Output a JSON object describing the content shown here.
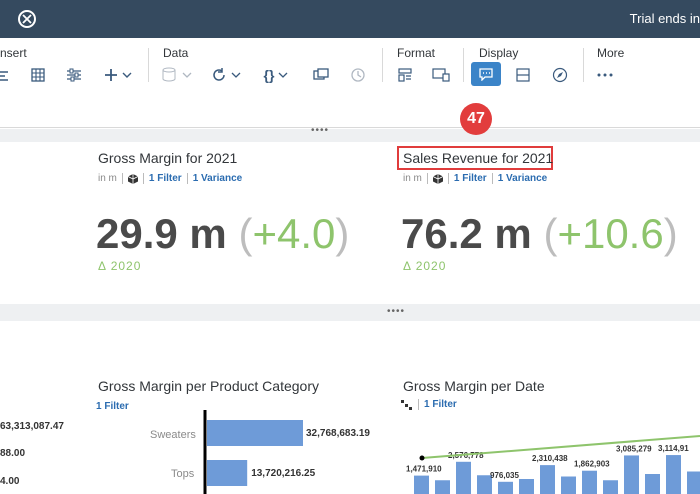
{
  "header": {
    "trial_text": "Trial ends in"
  },
  "toolbar": {
    "groups": {
      "insert": "nsert",
      "data": "Data",
      "format": "Format",
      "display": "Display",
      "more": "More"
    },
    "json_icon": "{}"
  },
  "step_badge": "47",
  "kpi_tiles": [
    {
      "title": "Gross Margin for 2021",
      "unit": "in m",
      "filter": "1 Filter",
      "variance": "1 Variance",
      "value": "29.9 m",
      "delta_value": "+4.0",
      "delta_label": "Δ 2020"
    },
    {
      "title": "Sales Revenue for 2021",
      "unit": "in m",
      "filter": "1 Filter",
      "variance": "1 Variance",
      "value": "76.2 m",
      "delta_value": "+10.6",
      "delta_label": "Δ 2020"
    }
  ],
  "left_partial_values": [
    "63,313,087.47",
    "88.00",
    "4.00"
  ],
  "charts": [
    {
      "title": "Gross Margin per Product Category",
      "filter": "1 Filter"
    },
    {
      "title": "Gross Margin per Date",
      "filter": "1 Filter"
    }
  ],
  "chart_data": [
    {
      "type": "bar",
      "title": "Gross Margin per Product Category",
      "categories": [
        "Sweaters",
        "Tops"
      ],
      "values": [
        32768683.19,
        13720216.25
      ],
      "value_labels": [
        "32,768,683.19",
        "13,720,216.25"
      ]
    },
    {
      "type": "bar",
      "title": "Gross Margin per Date",
      "value_labels": [
        "1,471,910",
        "2,576,778",
        "976,035",
        "2,310,438",
        "1,862,903",
        "3,085,279",
        "3,114,91"
      ],
      "values": [
        1471910,
        2576778,
        976035,
        2310438,
        1862903,
        3085279,
        3114910
      ]
    }
  ],
  "colors": {
    "shell": "#354a5f",
    "accent": "#3b84c8",
    "bar": "#6e9bd8",
    "positive": "#8ec46c",
    "highlight": "#e03c3c"
  }
}
